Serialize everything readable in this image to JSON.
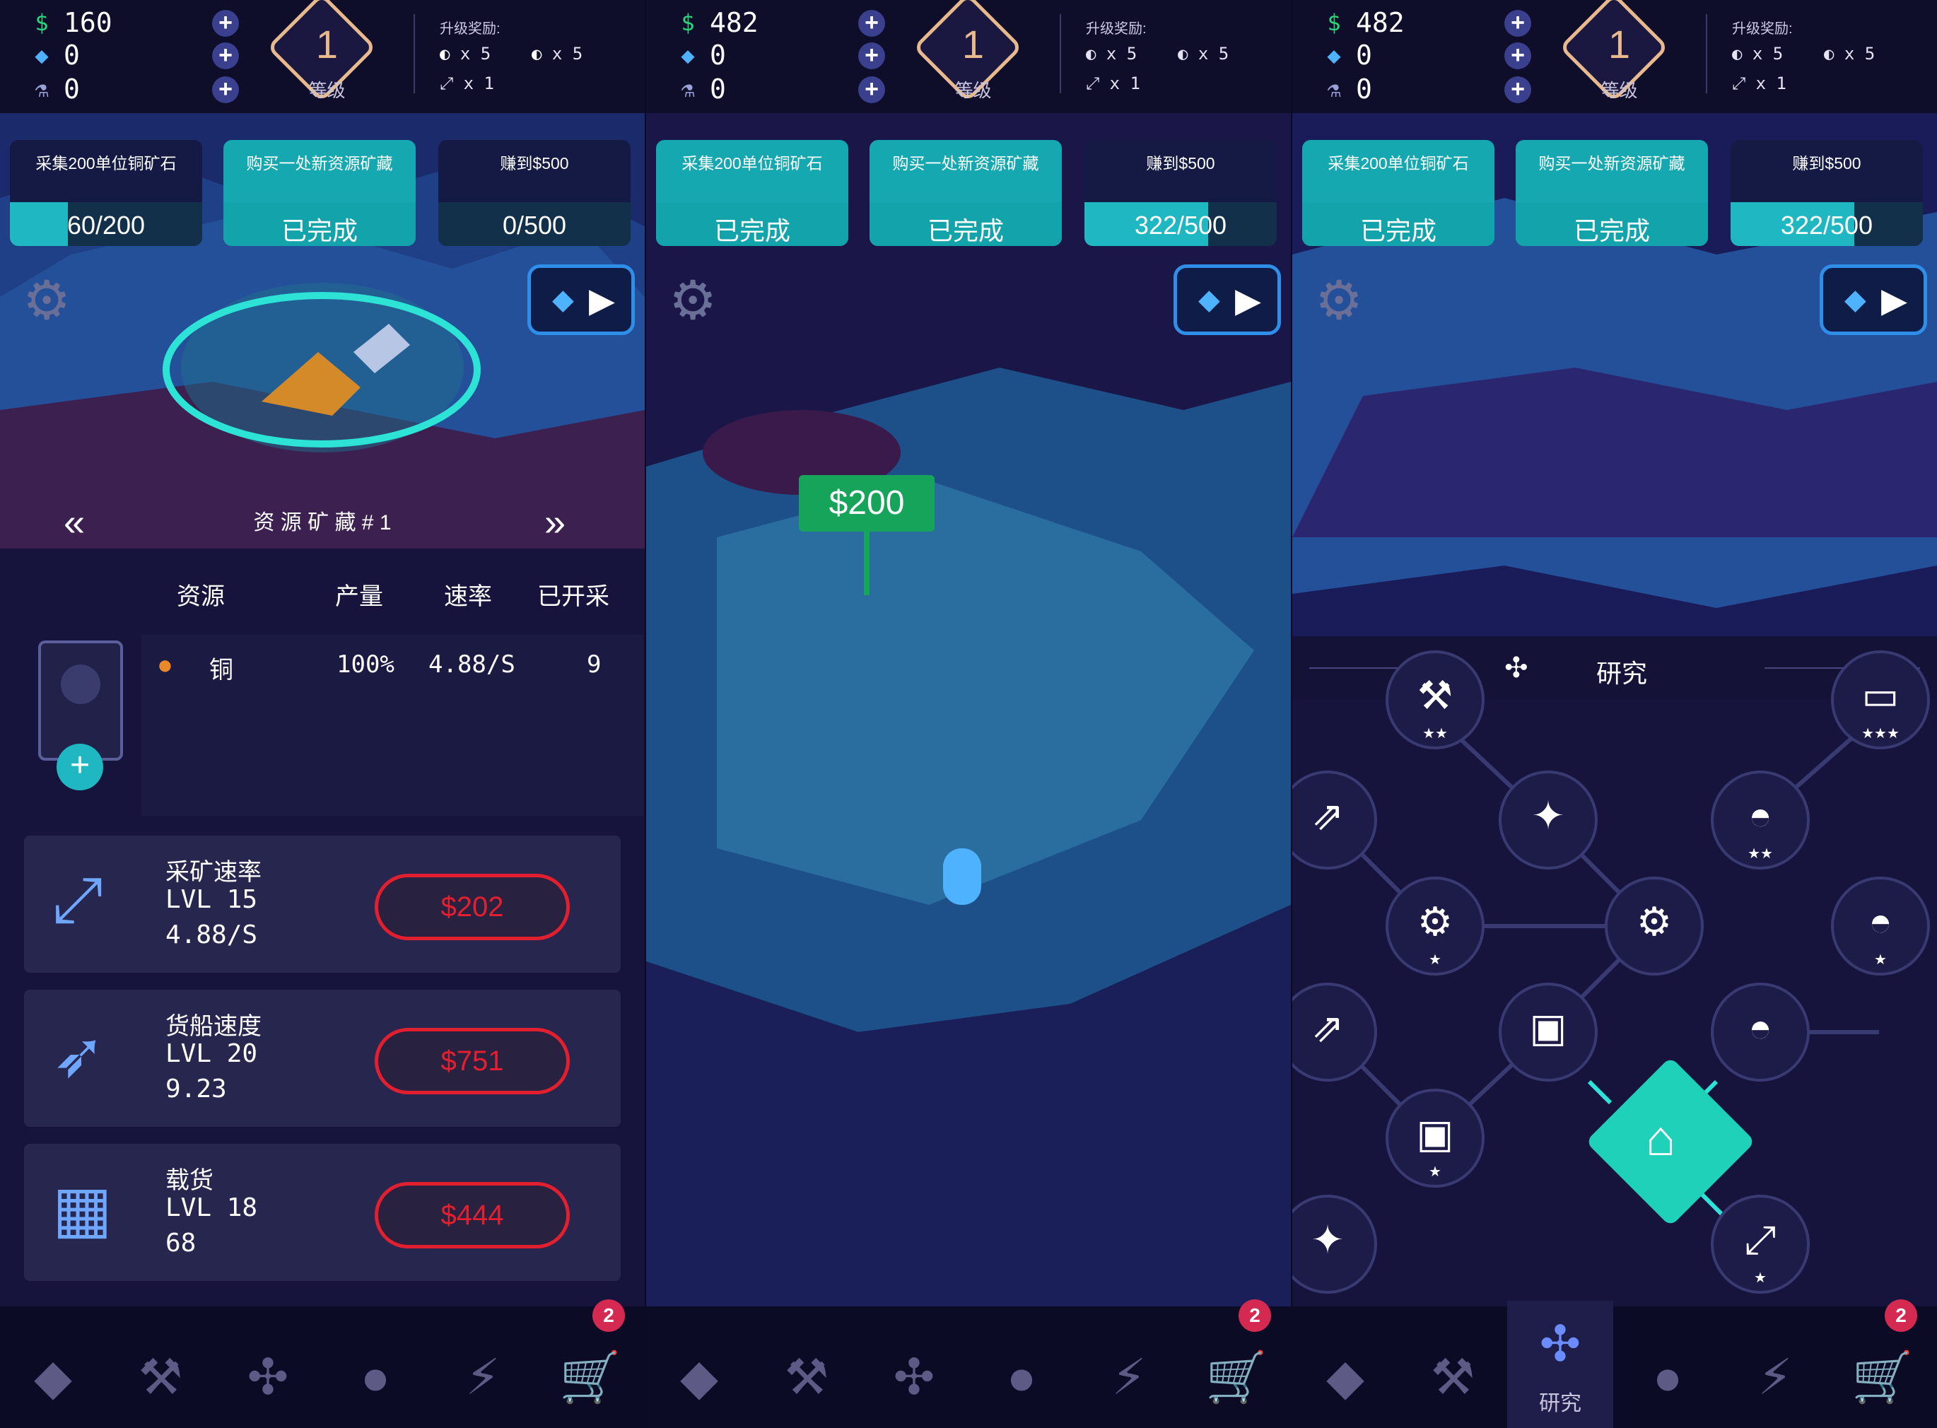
{
  "hud_panels": [
    {
      "money": "160",
      "gems": "0",
      "flask": "0"
    },
    {
      "money": "482",
      "gems": "0",
      "flask": "0"
    },
    {
      "money": "482",
      "gems": "0",
      "flask": "0"
    }
  ],
  "level": {
    "number": "1",
    "label": "等级"
  },
  "rewards": {
    "title": "升级奖励:",
    "a": "x 5",
    "b": "x 5",
    "c": "x 1"
  },
  "quests": [
    {
      "title": "采集200单位铜矿石",
      "p1": "60/200",
      "p1_fill": 0.3,
      "done": "已完成"
    },
    {
      "title": "购买一处新资源矿藏",
      "done": "已完成"
    },
    {
      "title": "赚到$500",
      "p1": "0/500",
      "p1_fill": 0.0,
      "p2": "322/500",
      "p2_fill": 0.644
    }
  ],
  "mine_name": "资 源 矿 藏 # 1",
  "table": {
    "headers": [
      "资源",
      "产量",
      "速率",
      "已开采"
    ],
    "row": {
      "name": "铜",
      "yield": "100%",
      "rate": "4.88/S",
      "mined": "9"
    }
  },
  "upgrades": [
    {
      "name": "采矿速率",
      "lvl": "LVL 15",
      "val": "4.88/S",
      "price": "$202",
      "icon": "drill-icon"
    },
    {
      "name": "货船速度",
      "lvl": "LVL 20",
      "val": "9.23",
      "price": "$751",
      "icon": "rocket-icon"
    },
    {
      "name": "载货",
      "lvl": "LVL 18",
      "val": "68",
      "price": "$444",
      "icon": "cubes-icon"
    }
  ],
  "sign_price": "$200",
  "research": {
    "title": "研究"
  },
  "nav": {
    "research_label": "研究",
    "badge": "2"
  },
  "colors": {
    "accent": "#1fb8c2",
    "price": "#e31f30",
    "badge": "#d42a52",
    "level": "#e7b98c"
  }
}
